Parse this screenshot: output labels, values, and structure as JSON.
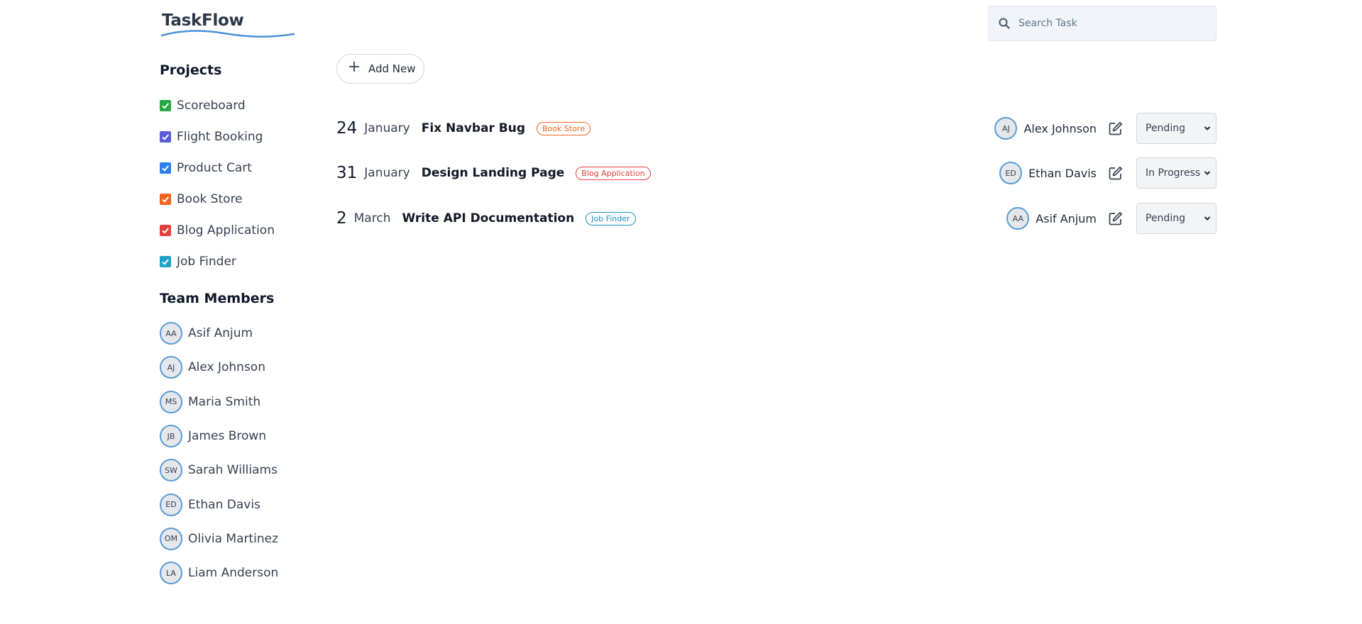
{
  "app": {
    "title": "TaskFlow"
  },
  "search": {
    "placeholder": "Search Task"
  },
  "sidebar": {
    "projects_title": "Projects",
    "projects": [
      {
        "label": "Scoreboard",
        "color": "#28a745"
      },
      {
        "label": "Flight Booking",
        "color": "#5b5bd6"
      },
      {
        "label": "Product Cart",
        "color": "#2f80ed"
      },
      {
        "label": "Book Store",
        "color": "#f06421"
      },
      {
        "label": "Blog Application",
        "color": "#e53e3e"
      },
      {
        "label": "Job Finder",
        "color": "#1fa2c8"
      }
    ],
    "members_title": "Team Members",
    "members": [
      {
        "initials": "AA",
        "name": "Asif Anjum"
      },
      {
        "initials": "AJ",
        "name": "Alex Johnson"
      },
      {
        "initials": "MS",
        "name": "Maria Smith"
      },
      {
        "initials": "JB",
        "name": "James Brown"
      },
      {
        "initials": "SW",
        "name": "Sarah Williams"
      },
      {
        "initials": "ED",
        "name": "Ethan Davis"
      },
      {
        "initials": "OM",
        "name": "Olivia Martinez"
      },
      {
        "initials": "LA",
        "name": "Liam Anderson"
      }
    ]
  },
  "toolbar": {
    "add_label": "Add New"
  },
  "tasks": [
    {
      "day": "24",
      "month": "January",
      "title": "Fix Navbar Bug",
      "tag": "Book Store",
      "tag_color": "#f06421",
      "assignee_initials": "AJ",
      "assignee": "Alex Johnson",
      "status": "Pending"
    },
    {
      "day": "31",
      "month": "January",
      "title": "Design Landing Page",
      "tag": "Blog Application",
      "tag_color": "#e53e3e",
      "assignee_initials": "ED",
      "assignee": "Ethan Davis",
      "status": "In Progress"
    },
    {
      "day": "2",
      "month": "March",
      "title": "Write API Documentation",
      "tag": "Job Finder",
      "tag_color": "#1a8fc9",
      "assignee_initials": "AA",
      "assignee": "Asif Anjum",
      "status": "Pending"
    }
  ]
}
